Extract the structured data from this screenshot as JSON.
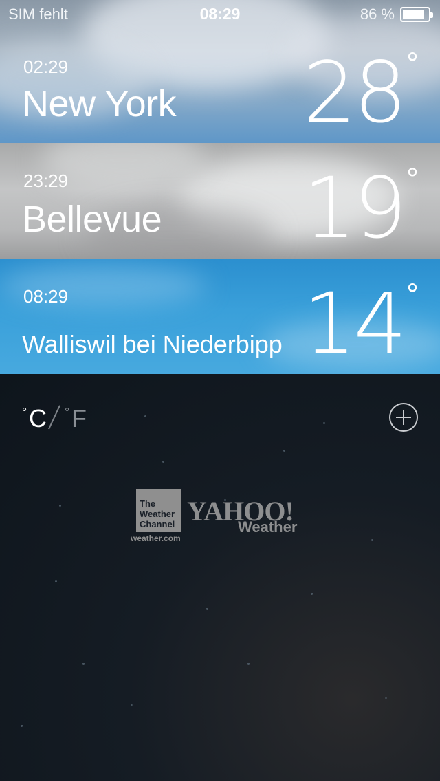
{
  "status_bar": {
    "carrier": "SIM fehlt",
    "time": "08:29",
    "battery_percent": "86 %",
    "battery_level": 0.86
  },
  "cities": [
    {
      "local_time": "02:29",
      "name": "New York",
      "temperature": "28",
      "degree_symbol": "°"
    },
    {
      "local_time": "23:29",
      "name": "Bellevue",
      "temperature": "19",
      "degree_symbol": "°"
    },
    {
      "local_time": "08:29",
      "name": "Walliswil bei Niederbipp",
      "temperature": "14",
      "degree_symbol": "°"
    }
  ],
  "units": {
    "celsius": "C",
    "fahrenheit": "F",
    "degree_ring": "°",
    "active": "celsius"
  },
  "add_button_icon": "plus-circle-icon",
  "attribution": {
    "twc_line1": "The",
    "twc_line2": "Weather",
    "twc_line3": "Channel",
    "twc_url": "weather.com",
    "yahoo": "YAHOO!",
    "yahoo_sub": "Weather"
  },
  "colors": {
    "ny_sky": "#7fa6c8",
    "bellevue_sky": "#b7b8b9",
    "walliswil_sky": "#3aa0da",
    "night_bg": "#0f161d"
  }
}
